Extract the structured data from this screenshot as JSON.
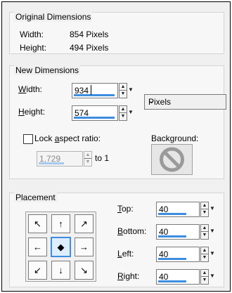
{
  "original": {
    "title": "Original Dimensions",
    "width_label": "Width:",
    "width_value": "854 Pixels",
    "height_label": "Height:",
    "height_value": "494 Pixels"
  },
  "new_dims": {
    "title": "New Dimensions",
    "width_label_u": "W",
    "width_label_rest": "idth:",
    "width_value": "934",
    "height_label_u": "H",
    "height_label_rest": "eight:",
    "height_value": "574",
    "units": "Pixels",
    "lock_label_pre": "Lock ",
    "lock_label_u": "a",
    "lock_label_post": "spect ratio:",
    "ratio_value": "1,729",
    "ratio_suffix": "to 1",
    "background_label": "Background:"
  },
  "placement": {
    "title": "Placement",
    "grid": [
      "↖",
      "↑",
      "↗",
      "←",
      "◆",
      "→",
      "↙",
      "↓",
      "↘"
    ],
    "top_label_u": "T",
    "top_label_rest": "op:",
    "top_value": "40",
    "bottom_label_u": "B",
    "bottom_label_rest": "ottom:",
    "bottom_value": "40",
    "left_label_u": "L",
    "left_label_rest": "eft:",
    "left_value": "40",
    "right_label_u": "R",
    "right_label_rest": "ight:",
    "right_value": "40"
  },
  "colors": {
    "accent": "#3c8de0"
  }
}
